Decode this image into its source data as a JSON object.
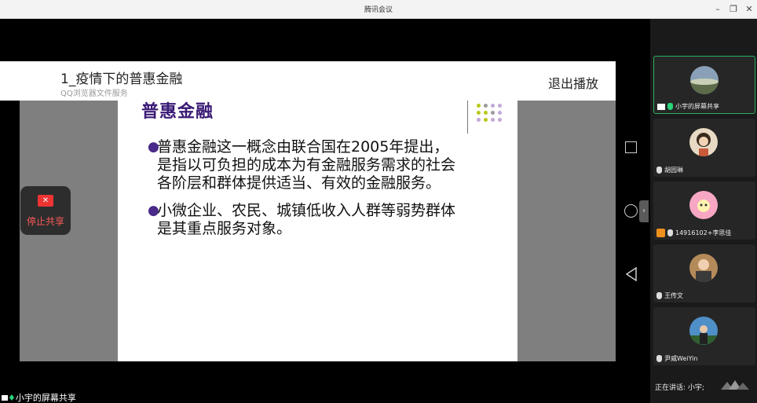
{
  "window": {
    "title": "腾讯会议",
    "minimize": "–",
    "maximize": "❐",
    "close": "✕"
  },
  "viewer": {
    "doc_title": "1_疫情下的普惠金融",
    "doc_subtitle": "QQ浏览器文件服务",
    "exit_label": "退出播放",
    "collapse_glyph": "›"
  },
  "slide": {
    "heading": "普惠金融",
    "bullets": [
      {
        "lines": [
          "普惠金融这一概念由联合国在2005年提出，",
          "是指以可负担的成本为有金融服务需求的社会",
          "各阶层和群体提供适当、有效的金融服务。"
        ]
      },
      {
        "lines": [
          "小微企业、农民、城镇低收入人群等弱势群体",
          "是其重点服务对象。"
        ]
      }
    ],
    "dot_colors": [
      "#b9c91c",
      "#9b9b9b",
      "#c2a9d8"
    ]
  },
  "stop_share": {
    "label": "停止共享",
    "icon": "screen-share-stop-icon"
  },
  "bottom_label": "小宇的屏幕共享",
  "participants": [
    {
      "name": "小宇的屏幕共享",
      "icons": [
        "screen-icon",
        "mic-icon"
      ],
      "active": true
    },
    {
      "name": "胡园琳",
      "icons": [
        "mic-icon"
      ],
      "active": false
    },
    {
      "name": "14916102+李思佳",
      "icons": [
        "person-icon",
        "mic-icon"
      ],
      "active": false
    },
    {
      "name": "王传文",
      "icons": [
        "mic-icon"
      ],
      "active": false
    },
    {
      "name": "尹威WeiYin",
      "icons": [
        "mic-icon"
      ],
      "active": false
    }
  ],
  "speaking": "正在讲话: 小宇;",
  "colors": {
    "active_border": "#27b060",
    "stop_text": "#ff5a5a",
    "heading": "#3a1a75"
  }
}
